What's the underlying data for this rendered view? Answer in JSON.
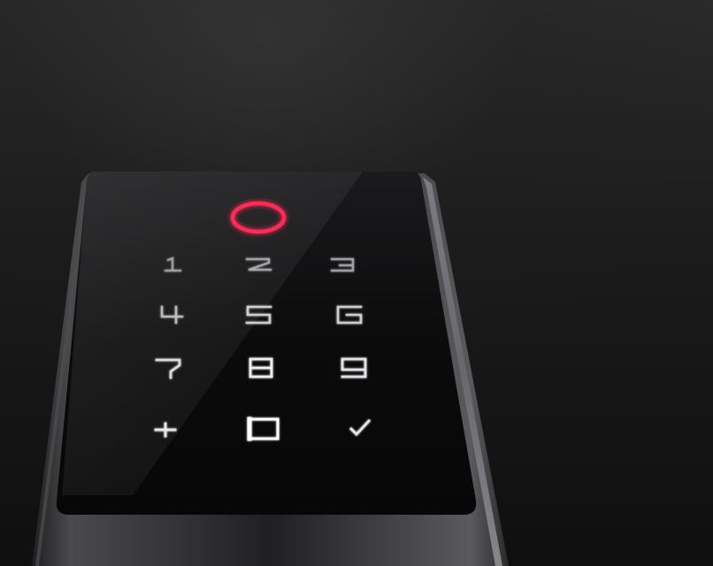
{
  "device": {
    "name": "",
    "fingerprint_ring_color": "#ff2a55",
    "glass_color": "#0c0c0d",
    "frame_color": "#3a3a3c"
  },
  "keypad": {
    "keys": [
      {
        "id": "1",
        "icon": "digit-1-icon",
        "brightness": 0.55
      },
      {
        "id": "2",
        "icon": "digit-2-icon",
        "brightness": 0.6
      },
      {
        "id": "3",
        "icon": "digit-3-icon",
        "brightness": 0.6
      },
      {
        "id": "4",
        "icon": "digit-4-icon",
        "brightness": 0.7
      },
      {
        "id": "5",
        "icon": "digit-5-icon",
        "brightness": 0.8
      },
      {
        "id": "6",
        "icon": "digit-6-icon",
        "brightness": 0.8
      },
      {
        "id": "7",
        "icon": "digit-7-icon",
        "brightness": 0.85
      },
      {
        "id": "8",
        "icon": "digit-8-icon",
        "brightness": 0.95
      },
      {
        "id": "9",
        "icon": "digit-9-icon",
        "brightness": 0.9
      },
      {
        "id": "+",
        "icon": "plus-icon",
        "brightness": 0.9
      },
      {
        "id": "0",
        "icon": "digit-0-icon",
        "brightness": 1.0
      },
      {
        "id": "✓",
        "icon": "checkmark-icon",
        "brightness": 0.9
      }
    ]
  }
}
